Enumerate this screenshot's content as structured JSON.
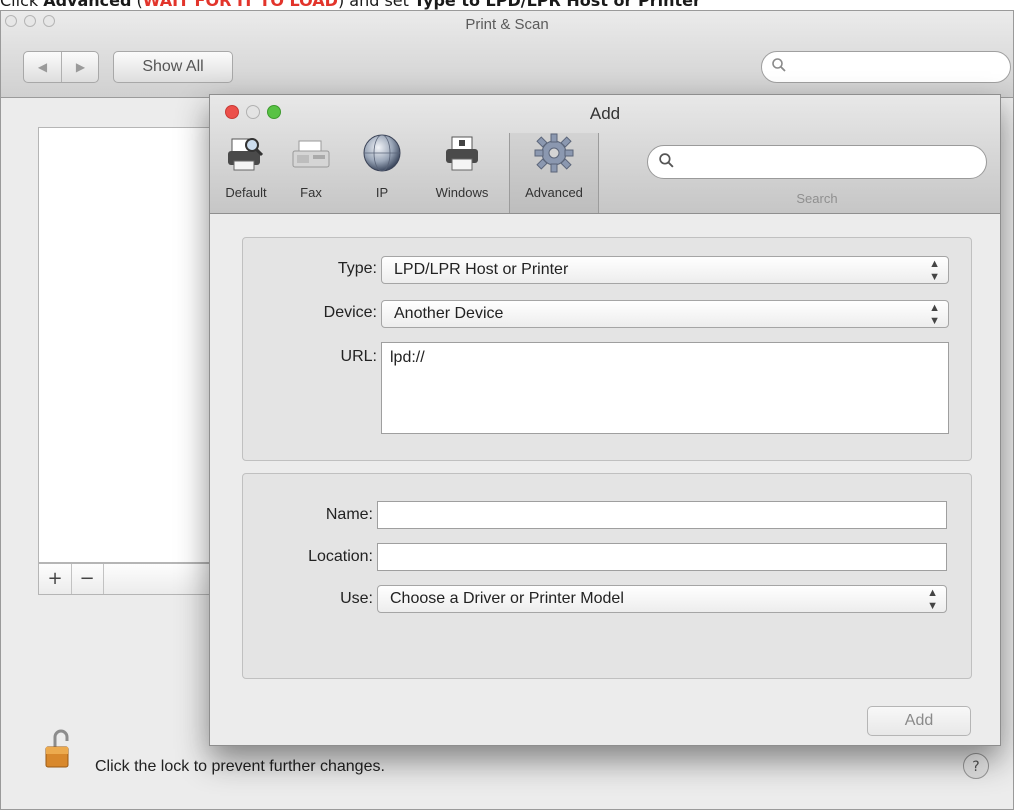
{
  "banner": {
    "part1": "Click ",
    "part2": "Advanced",
    "part3": " (",
    "part4": "WAIT FOR IT TO LOAD",
    "part5": ") and set ",
    "part6": "Type to LPD/LPR Host or Printer"
  },
  "back_window": {
    "title": "Print & Scan",
    "show_all_label": "Show All",
    "search_placeholder": "",
    "add_button": "+",
    "remove_button": "−",
    "lock_text": "Click the lock to prevent further changes.",
    "help_label": "?"
  },
  "dialog": {
    "title": "Add",
    "toolbar": [
      {
        "label": "Default",
        "icon": "printer-magnifier-icon"
      },
      {
        "label": "Fax",
        "icon": "fax-icon"
      },
      {
        "label": "IP",
        "icon": "globe-icon"
      },
      {
        "label": "Windows",
        "icon": "printer-icon"
      },
      {
        "label": "Advanced",
        "icon": "gear-icon"
      }
    ],
    "search_label": "Search",
    "form": {
      "type_label": "Type:",
      "type_value": "LPD/LPR Host or Printer",
      "device_label": "Device:",
      "device_value": "Another Device",
      "url_label": "URL:",
      "url_value": "lpd://",
      "name_label": "Name:",
      "name_value": "",
      "location_label": "Location:",
      "location_value": "",
      "use_label": "Use:",
      "use_value": "Choose a Driver or Printer Model"
    },
    "add_button": "Add"
  },
  "colors": {
    "banner_accent": "#e2342b",
    "traffic_red": "#ec4f4a",
    "traffic_yellow": "#f3bf3b",
    "traffic_green": "#58c244"
  }
}
